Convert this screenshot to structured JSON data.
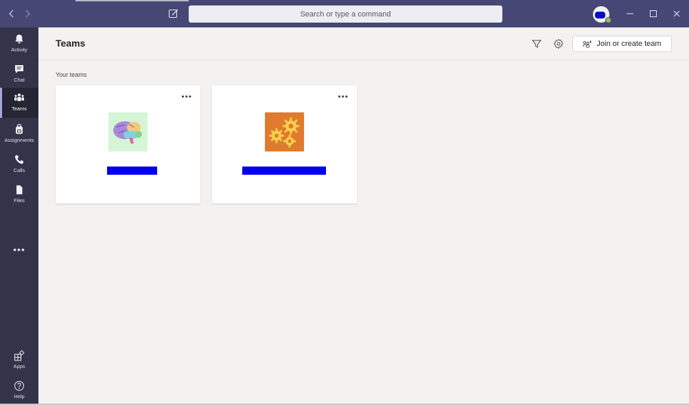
{
  "titlebar": {
    "search_placeholder": "Search or type a command",
    "back_label": "Back",
    "forward_label": "Forward"
  },
  "rail": {
    "items": [
      {
        "label": "Activity",
        "icon": "bell-icon"
      },
      {
        "label": "Chat",
        "icon": "chat-icon"
      },
      {
        "label": "Teams",
        "icon": "teams-icon",
        "active": true
      },
      {
        "label": "Assignments",
        "icon": "backpack-icon"
      },
      {
        "label": "Calls",
        "icon": "phone-icon"
      },
      {
        "label": "Files",
        "icon": "file-icon"
      }
    ],
    "more": "•••",
    "bottom": [
      {
        "label": "Apps",
        "icon": "apps-icon"
      },
      {
        "label": "Help",
        "icon": "help-icon"
      }
    ]
  },
  "header": {
    "title": "Teams",
    "join_button": "Join or create team"
  },
  "main": {
    "section_label": "Your teams",
    "teams": [
      {
        "more": "•••",
        "image": "brain-icon",
        "name_redacted": true
      },
      {
        "more": "•••",
        "image": "gears-icon",
        "name_redacted": true
      }
    ]
  },
  "colors": {
    "titlebar": "#464775",
    "rail": "#33344a",
    "accent": "#6264a7",
    "redaction": "#0000ee"
  }
}
